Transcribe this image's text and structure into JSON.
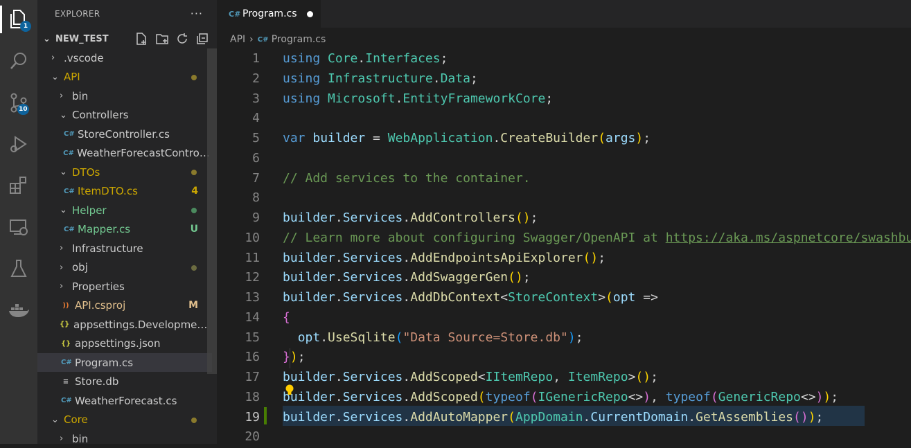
{
  "activity_bar": {
    "explorer_badge": "1",
    "scm_badge": "10"
  },
  "sidebar": {
    "title": "EXPLORER",
    "more_label": "···",
    "root": "NEW_TEST",
    "tree": [
      {
        "label": ".vscode",
        "kind": "folder",
        "depth": 1,
        "open": false,
        "status": "",
        "color": "#cccccc"
      },
      {
        "label": "API",
        "kind": "folder",
        "depth": 1,
        "open": true,
        "status": "dot",
        "color": "#cca700"
      },
      {
        "label": "bin",
        "kind": "folder",
        "depth": 2,
        "open": false,
        "status": "",
        "color": "#cccccc"
      },
      {
        "label": "Controllers",
        "kind": "folder",
        "depth": 2,
        "open": true,
        "status": "",
        "color": "#cccccc"
      },
      {
        "label": "StoreController.cs",
        "kind": "cs",
        "depth": 3,
        "status": "",
        "color": "#cccccc"
      },
      {
        "label": "WeatherForecastControll...",
        "kind": "cs",
        "depth": 3,
        "status": "",
        "color": "#cccccc"
      },
      {
        "label": "DTOs",
        "kind": "folder",
        "depth": 2,
        "open": true,
        "status": "dot",
        "color": "#cca700"
      },
      {
        "label": "ItemDTO.cs",
        "kind": "cs",
        "depth": 3,
        "status": "4",
        "color": "#cca700"
      },
      {
        "label": "Helper",
        "kind": "folder",
        "depth": 2,
        "open": true,
        "status": "dotg",
        "color": "#73c991"
      },
      {
        "label": "Mapper.cs",
        "kind": "cs",
        "depth": 3,
        "status": "U",
        "color": "#73c991"
      },
      {
        "label": "Infrastructure",
        "kind": "folder",
        "depth": 2,
        "open": false,
        "status": "",
        "color": "#cccccc"
      },
      {
        "label": "obj",
        "kind": "folder",
        "depth": 2,
        "open": false,
        "status": "dotgray",
        "color": "#cccccc"
      },
      {
        "label": "Properties",
        "kind": "folder",
        "depth": 2,
        "open": false,
        "status": "",
        "color": "#cccccc"
      },
      {
        "label": "API.csproj",
        "kind": "rss",
        "depth": 2,
        "status": "M",
        "color": "#e2c08d"
      },
      {
        "label": "appsettings.Development.j...",
        "kind": "json",
        "depth": 2,
        "status": "",
        "color": "#cccccc"
      },
      {
        "label": "appsettings.json",
        "kind": "json",
        "depth": 2,
        "status": "",
        "color": "#cccccc"
      },
      {
        "label": "Program.cs",
        "kind": "cs",
        "depth": 2,
        "status": "",
        "color": "#cccccc",
        "selected": true
      },
      {
        "label": "Store.db",
        "kind": "db",
        "depth": 2,
        "status": "",
        "color": "#cccccc"
      },
      {
        "label": "WeatherForecast.cs",
        "kind": "cs",
        "depth": 2,
        "status": "",
        "color": "#cccccc"
      },
      {
        "label": "Core",
        "kind": "folder",
        "depth": 1,
        "open": true,
        "status": "dot",
        "color": "#cca700"
      },
      {
        "label": "bin",
        "kind": "folder",
        "depth": 2,
        "open": false,
        "status": "",
        "color": "#cccccc"
      }
    ]
  },
  "editor": {
    "tab_label": "Program.cs",
    "breadcrumb": [
      "API",
      "Program.cs"
    ],
    "current_line": 19,
    "lines": [
      "1",
      "2",
      "3",
      "4",
      "5",
      "6",
      "7",
      "8",
      "9",
      "10",
      "11",
      "12",
      "13",
      "14",
      "15",
      "16",
      "17",
      "18",
      "19",
      "20"
    ]
  }
}
